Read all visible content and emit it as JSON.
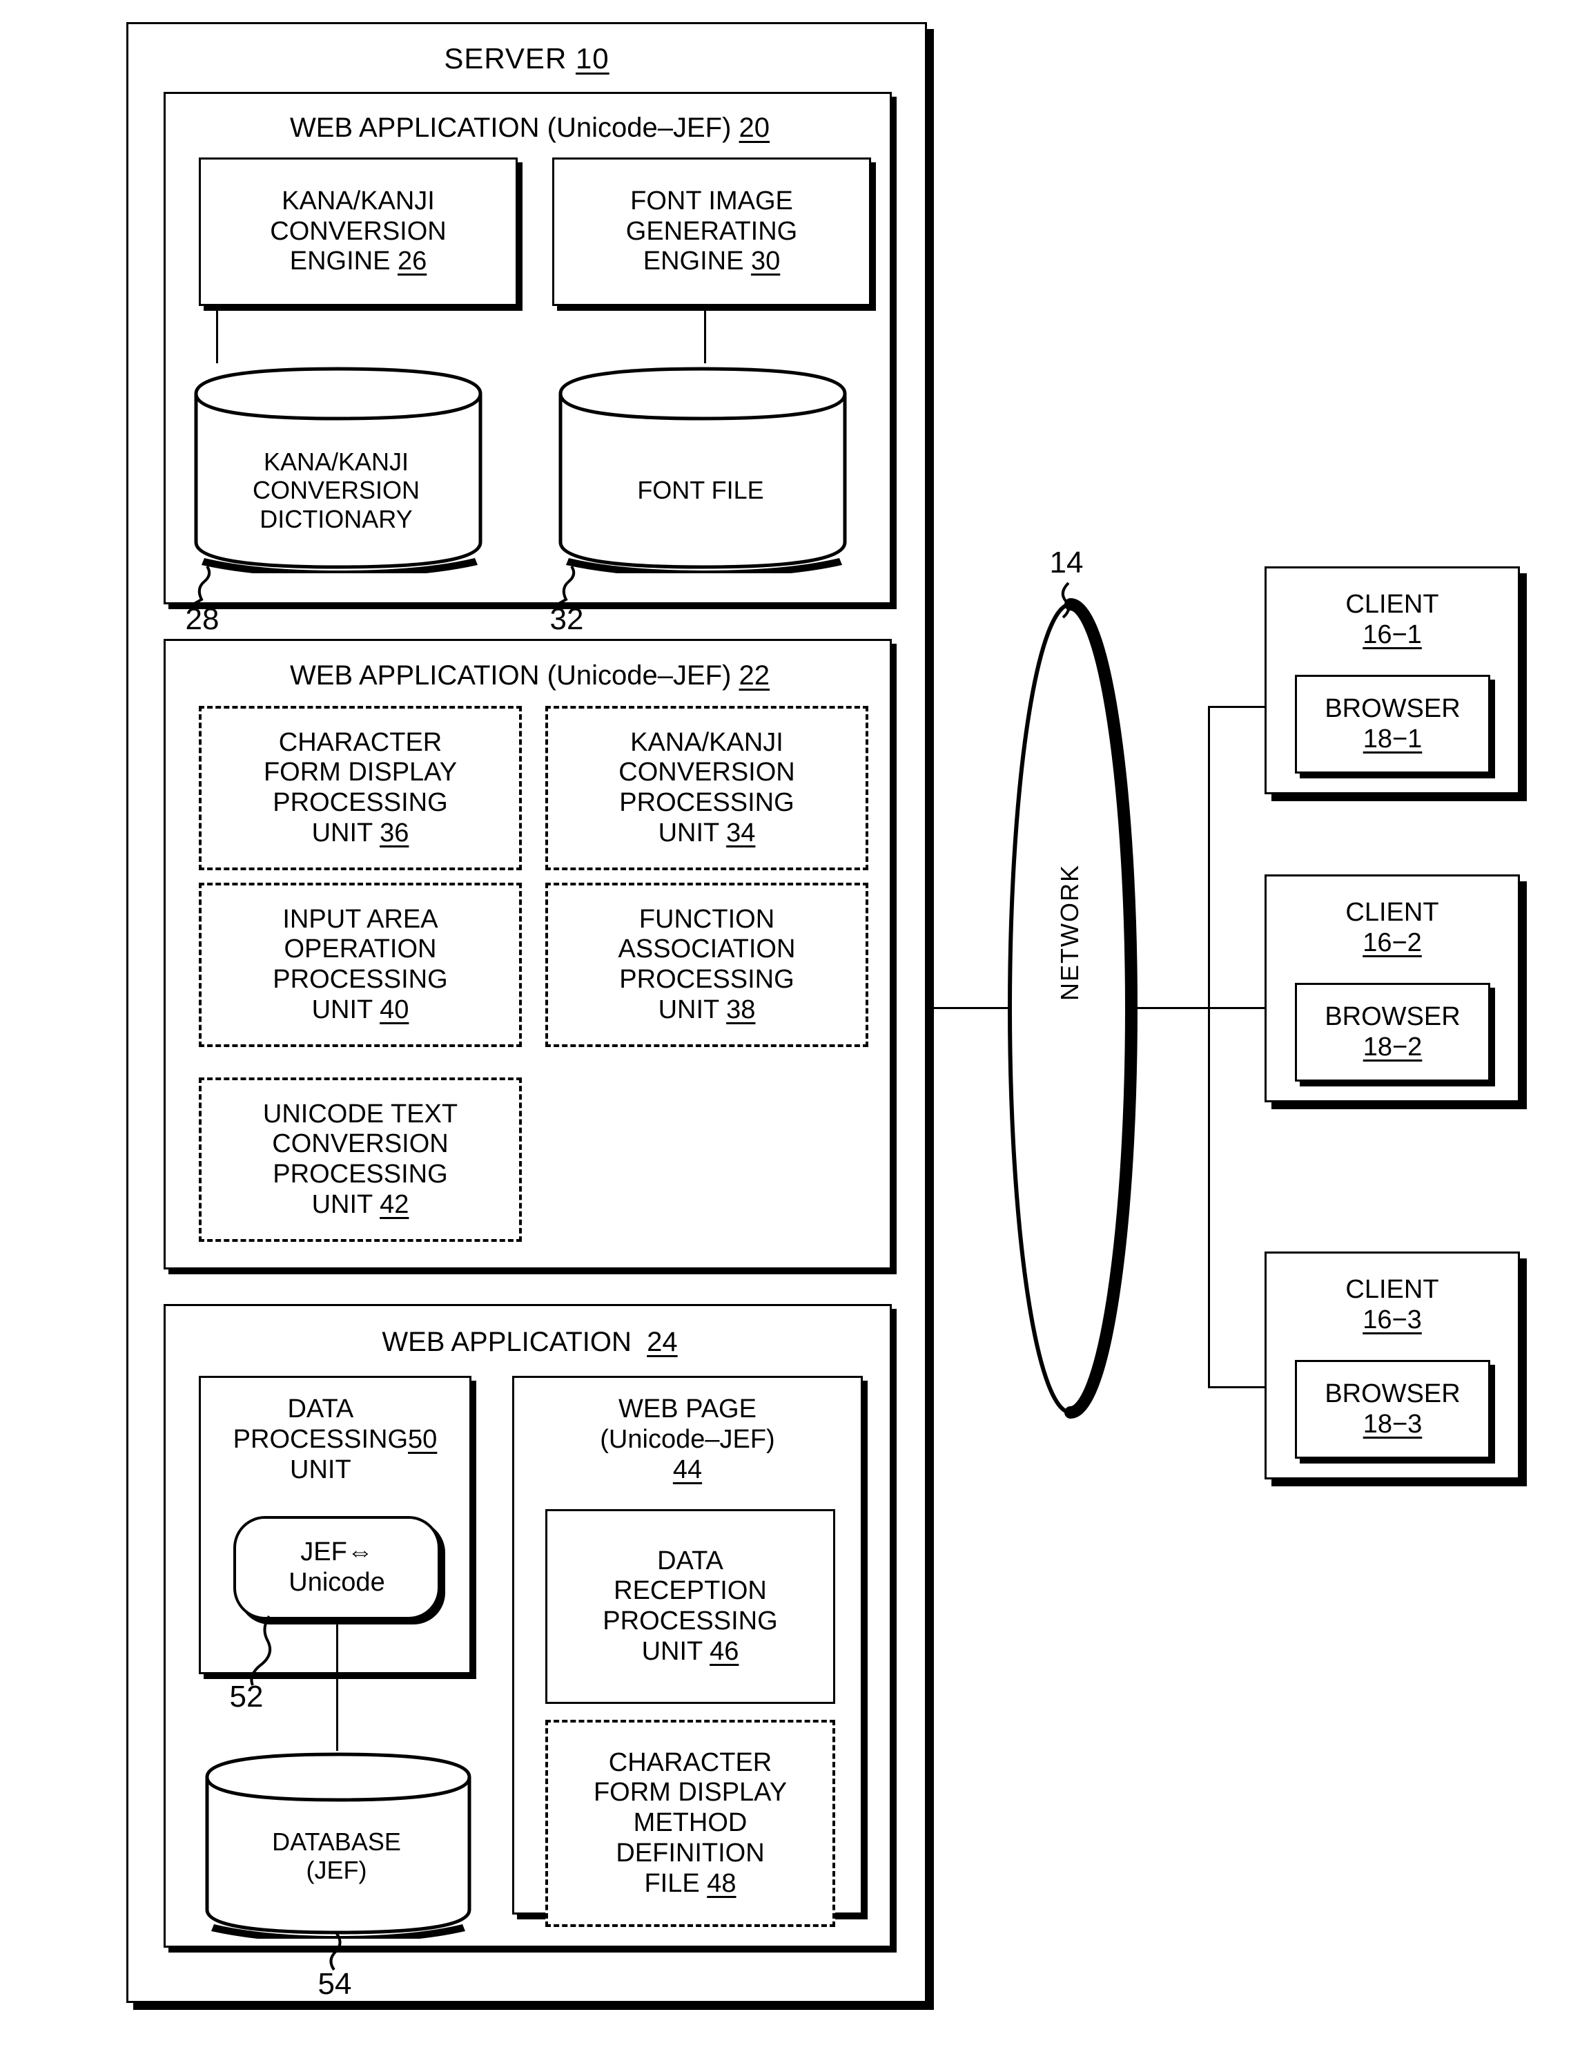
{
  "figure": {
    "server": {
      "title": "SERVER",
      "ref": "10",
      "app20": {
        "title": "WEB APPLICATION (Unicode–JEF)",
        "ref": "20",
        "boxes": [
          {
            "label": "KANA/KANJI\nCONVERSION\nENGINE",
            "ref": "26"
          },
          {
            "label": "FONT IMAGE\nGENERATING\nENGINE",
            "ref": "30"
          }
        ],
        "stores": [
          {
            "label": "KANA/KANJI\nCONVERSION\nDICTIONARY",
            "ref": "28"
          },
          {
            "label": "FONT FILE",
            "ref": "32"
          }
        ]
      },
      "app22": {
        "title": "WEB APPLICATION (Unicode–JEF)",
        "ref": "22",
        "units": [
          {
            "label": "CHARACTER\nFORM DISPLAY\nPROCESSING\nUNIT",
            "ref": "36"
          },
          {
            "label": "KANA/KANJI\nCONVERSION\nPROCESSING\nUNIT",
            "ref": "34"
          },
          {
            "label": "INPUT AREA\nOPERATION\nPROCESSING\nUNIT",
            "ref": "40"
          },
          {
            "label": "FUNCTION\nASSOCIATION\nPROCESSING\nUNIT",
            "ref": "38"
          },
          {
            "label": "UNICODE TEXT\nCONVERSION\nPROCESSING\nUNIT",
            "ref": "42"
          }
        ]
      },
      "app24": {
        "title": "WEB APPLICATION",
        "ref": "24",
        "data_processing": {
          "label": "DATA\nPROCESSING\nUNIT",
          "ref": "50"
        },
        "converter": {
          "line1": "JEF⇔",
          "line2": "Unicode",
          "ref": "52"
        },
        "database": {
          "label": "DATABASE\n(JEF)",
          "ref": "54"
        },
        "web_page": {
          "title": "WEB PAGE\n(Unicode–JEF)",
          "ref": "44"
        },
        "reception": {
          "label": "DATA\nRECEPTION\nPROCESSING\nUNIT",
          "ref": "46"
        },
        "definition_file": {
          "label": "CHARACTER\nFORM DISPLAY\nMETHOD\nDEFINITION\nFILE",
          "ref": "48"
        }
      }
    },
    "network": {
      "label": "NETWORK",
      "ref": "14"
    },
    "clients": [
      {
        "name": "CLIENT",
        "ref": "16−1",
        "browser_name": "BROWSER",
        "browser_ref": "18−1"
      },
      {
        "name": "CLIENT",
        "ref": "16−2",
        "browser_name": "BROWSER",
        "browser_ref": "18−2"
      },
      {
        "name": "CLIENT",
        "ref": "16−3",
        "browser_name": "BROWSER",
        "browser_ref": "18−3"
      }
    ]
  }
}
